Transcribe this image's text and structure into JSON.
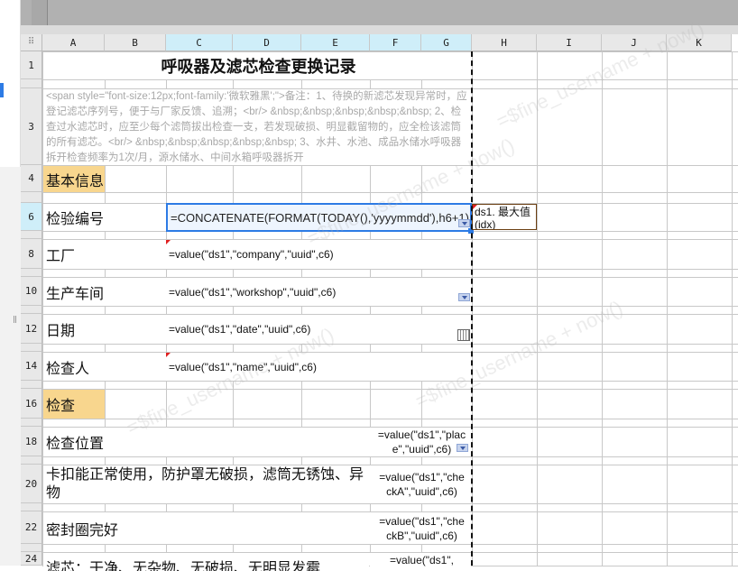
{
  "columns": [
    "A",
    "B",
    "C",
    "D",
    "E",
    "F",
    "G",
    "H",
    "I",
    "J",
    "K"
  ],
  "rows": [
    "1",
    "3",
    "4",
    "6",
    "8",
    "10",
    "12",
    "14",
    "16",
    "18",
    "20",
    "22",
    "24"
  ],
  "title": "呼吸器及滤芯检查更换记录",
  "remark": "<span style=\"font-size:12px;font-family:'微软雅黑';\">备注：1、待换的新滤芯发现异常时，应登记滤芯序列号，便于与厂家反馈、追溯；<br/> &nbsp;&nbsp;&nbsp;&nbsp;&nbsp; 2、检查过水滤芯时，应至少每个滤筒拔出检查一支，若发现破损、明显截留物的，应全检该滤筒的所有滤芯。<br/> &nbsp;&nbsp;&nbsp;&nbsp;&nbsp; 3、水井、水池、成品水储水呼吸器拆开检查频率为1次/月，源水储水、中间水箱呼吸器拆开",
  "section_basic": "基本信息",
  "section_check": "检查",
  "labels": {
    "r6": "检验编号",
    "r8": "工厂",
    "r10": "生产车间",
    "r12": "日期",
    "r14": "检查人",
    "r18": "检查位置",
    "r20": "卡扣能正常使用，防护罩无破损，滤筒无锈蚀、异物",
    "r22": "密封圈完好",
    "r24": "滤芯：干净、无杂物、无破损、无明显发霉"
  },
  "formulas": {
    "r6": "=CONCATENATE(FORMAT(TODAY(),'yyyymmdd'),h6+1)",
    "h6": "ds1. 最大值(idx)",
    "r8": "=value(\"ds1\",\"company\",\"uuid\",c6)",
    "r10": "=value(\"ds1\",\"workshop\",\"uuid\",c6)",
    "r12": "=value(\"ds1\",\"date\",\"uuid\",c6)",
    "r14": "=value(\"ds1\",\"name\",\"uuid\",c6)",
    "r18": "=value(\"ds1\",\"place\",\"uuid\",c6)",
    "r20": "=value(\"ds1\",\"checkA\",\"uuid\",c6)",
    "r22": "=value(\"ds1\",\"checkB\",\"uuid\",c6)",
    "r24": "=value(\"ds1\","
  },
  "watermark": "=$fine_username + now()",
  "colors": {
    "selection": "#2d7be5",
    "section": "#f8d68e",
    "header_selected": "#cfeef9"
  }
}
